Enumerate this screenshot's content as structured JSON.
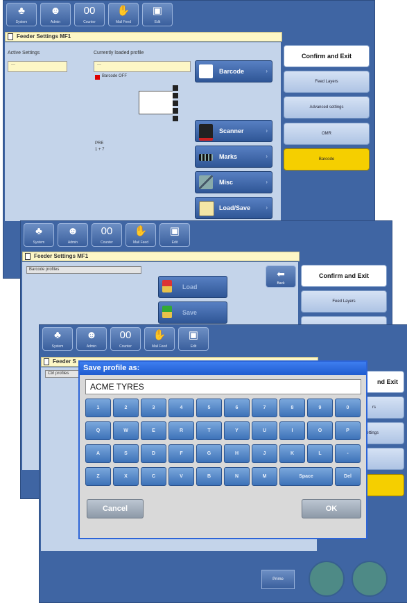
{
  "toolbar": {
    "buttons": [
      {
        "label": "System",
        "icon": "system-icon"
      },
      {
        "label": "Admin",
        "icon": "admin-icon"
      },
      {
        "label": "Counter",
        "icon": "counter-icon"
      },
      {
        "label": "Mail Feed",
        "icon": "feed-icon"
      },
      {
        "label": "Edit",
        "icon": "disk-icon"
      }
    ]
  },
  "screen1": {
    "window_title": "Feeder Settings MF1",
    "active_settings_label": "Active Settings",
    "active_settings_value": "---",
    "loaded_profile_label": "Currently loaded profile",
    "loaded_profile_value": "---",
    "barcode_status": "Barcode OFF",
    "info_line1": "PRE",
    "info_line2": "1 + 7",
    "side_buttons": [
      "Barcode",
      "Scanner",
      "Marks",
      "Misc",
      "Load/Save"
    ],
    "right_buttons": [
      "Confirm and Exit",
      "Feed Layers",
      "Advanced settings",
      "OMR",
      "Barcode"
    ]
  },
  "screen2": {
    "window_title": "Feeder Settings MF1",
    "list_label": "Barcode profiles",
    "load_button": "Load",
    "save_button": "Save",
    "back_button": "Back",
    "right_buttons": [
      "Confirm and Exit",
      "Feed Layers"
    ]
  },
  "screen3": {
    "window_title": "Feeder S",
    "list_label": "Ctrl profiles",
    "right_buttons": [
      "nd Exit",
      "rs",
      "ettings"
    ],
    "bottom_button": "Prime"
  },
  "dialog": {
    "title": "Save profile as:",
    "input_value": "ACME TYRES",
    "rows": [
      [
        "1",
        "2",
        "3",
        "4",
        "5",
        "6",
        "7",
        "8",
        "9",
        "0"
      ],
      [
        "Q",
        "W",
        "E",
        "R",
        "T",
        "Y",
        "U",
        "I",
        "O",
        "P"
      ],
      [
        "A",
        "S",
        "D",
        "F",
        "G",
        "H",
        "J",
        "K",
        "L",
        "-"
      ],
      [
        "Z",
        "X",
        "C",
        "V",
        "B",
        "N",
        "M",
        "Space",
        "Del"
      ]
    ],
    "cancel_label": "Cancel",
    "ok_label": "OK"
  },
  "colors": {
    "screen_bg": "#3f65a3",
    "panel": "#c4d4ea",
    "title_yellow": "#fdf7c6",
    "highlight_yellow": "#f5cf00",
    "dialog_title": "#2c64d8"
  }
}
